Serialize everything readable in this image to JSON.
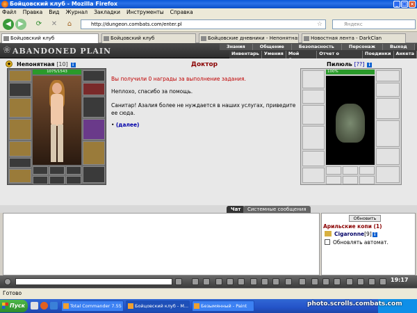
{
  "window": {
    "title": "Бойцовский клуб - Mozilla Firefox"
  },
  "menubar": [
    "Файл",
    "Правка",
    "Вид",
    "Журнал",
    "Закладки",
    "Инструменты",
    "Справка"
  ],
  "nav": {
    "url": "http://dungeon.combats.com/enter.pl",
    "search_placeholder": "Яндекс"
  },
  "tabs": [
    "Бойцовский клуб",
    "Бойцовский клуб",
    "Бойцовские дневники - Непонятная",
    "Новостная лента - DarkClan"
  ],
  "game": {
    "logo": "ABANDONED PLAIN",
    "menu_top": [
      "Знания",
      "Общение",
      "Безопасность",
      "Персонаж",
      "Выход"
    ],
    "menu_bottom": [
      "Инвентарь",
      "Умения",
      "Мой Скролл",
      "Отчет о переводах",
      "Поединки",
      "Анкета"
    ]
  },
  "player": {
    "name": "Непонятная",
    "level": "[10]",
    "hp": "1075/1543",
    "info_icon": "i"
  },
  "dialog": {
    "title": "Доктор",
    "reward": "Вы получили 0 награды за выполнение задания.",
    "line1": "Неплохо, спасибо за помощь.",
    "line2a": "Санитар! Азалия более не нуждается в наших услугах, приведите",
    "line2b": "ее сюда.",
    "bullet": "•",
    "next_link": "(далее)"
  },
  "opponent": {
    "name": "Пилюль",
    "level": "[??]",
    "hp": "100%",
    "info_icon": "i"
  },
  "chat": {
    "tabs": [
      "Чат",
      "Системные сообщения"
    ]
  },
  "side": {
    "refresh_label": "Обновить",
    "location": "Арильские копи (1)",
    "player_name": "Cigaronne",
    "player_level": "[9]",
    "auto_refresh_label": "Обновлять автомат."
  },
  "clock": "19:17",
  "status": "Готово",
  "taskbar": {
    "start_label": "Пуск",
    "tasks": [
      "Total Commander 7.55 - ...",
      "Бойцовский клуб - М...",
      "Безымянный - Paint"
    ]
  },
  "watermark": "photo.scrolls.combats.com"
}
